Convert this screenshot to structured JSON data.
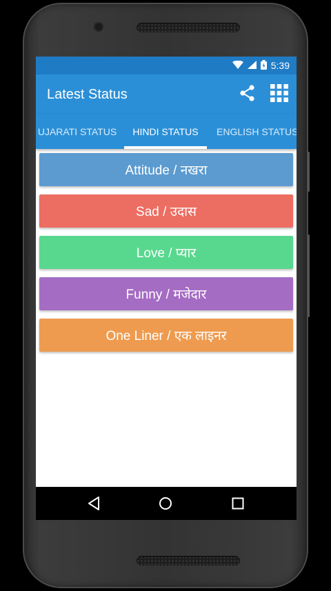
{
  "status_bar": {
    "time": "5:39"
  },
  "toolbar": {
    "title": "Latest Status",
    "share_icon": "share-icon",
    "grid_icon": "grid-icon"
  },
  "tabs": [
    {
      "label": "UJARATI STATUS",
      "active": false
    },
    {
      "label": "HINDI STATUS",
      "active": true
    },
    {
      "label": "ENGLISH STATUS",
      "active": false
    }
  ],
  "categories": [
    {
      "label": "Attitude / नखरा",
      "color": "#5b9bd0"
    },
    {
      "label": "Sad / उदास",
      "color": "#ec6d61"
    },
    {
      "label": "Love / प्यार",
      "color": "#58d88e"
    },
    {
      "label": "Funny / मजेदार",
      "color": "#a56cc4"
    },
    {
      "label": "One Liner / एक लाइनर",
      "color": "#ee9b4f"
    }
  ],
  "colors": {
    "status_bar": "#1f7bc4",
    "toolbar": "#2b8fd7"
  },
  "navigation": {
    "back_icon": "back-icon",
    "home_icon": "home-icon",
    "recents_icon": "recents-icon"
  }
}
